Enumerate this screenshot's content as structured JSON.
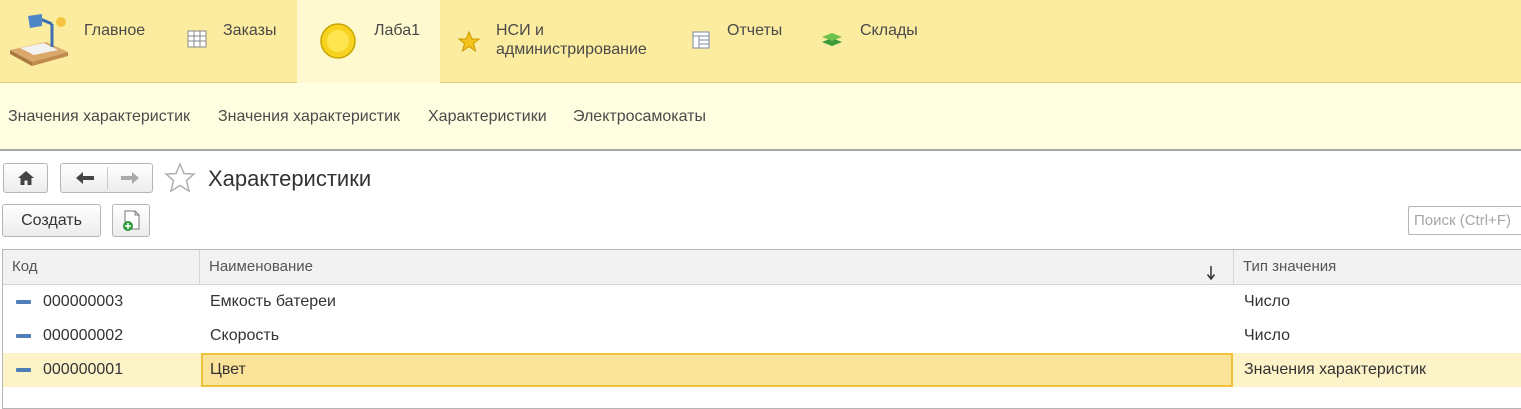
{
  "sections": [
    {
      "label": "Главное",
      "icon": "desk-lamp-icon"
    },
    {
      "label": "Заказы",
      "icon": "table-grid-icon"
    },
    {
      "label": "Лаба1",
      "icon": "yellow-circle-icon"
    },
    {
      "label": "НСИ и\nадминистрирование",
      "icon": "star-icon"
    },
    {
      "label": "Отчеты",
      "icon": "report-table-icon"
    },
    {
      "label": "Склады",
      "icon": "layers-icon"
    }
  ],
  "subnav": [
    "Значения характеристик",
    "Значения характеристик",
    "Характеристики",
    "Электросамокаты"
  ],
  "nav": {
    "home_icon": "home-icon",
    "back_icon": "arrow-left-icon",
    "forward_icon": "arrow-right-icon",
    "favorite_icon": "star-outline-icon"
  },
  "page": {
    "title": "Характеристики"
  },
  "toolbar": {
    "create_label": "Создать",
    "copy_icon": "add-document-icon"
  },
  "search": {
    "placeholder": "Поиск (Ctrl+F)"
  },
  "table": {
    "columns": [
      "Код",
      "Наименование",
      "Тип значения"
    ],
    "sort_icon": "sort-down-arrow-icon",
    "rows": [
      {
        "code": "000000003",
        "name": "Емкость батереи",
        "type": "Число"
      },
      {
        "code": "000000002",
        "name": "Скорость",
        "type": "Число"
      },
      {
        "code": "000000001",
        "name": "Цвет",
        "type": "Значения характеристик"
      }
    ]
  },
  "colors": {
    "topbar": "#fbec9f",
    "subbar": "#fffee0",
    "selection": "#fbe39a",
    "selection_border": "#f0c23b"
  }
}
